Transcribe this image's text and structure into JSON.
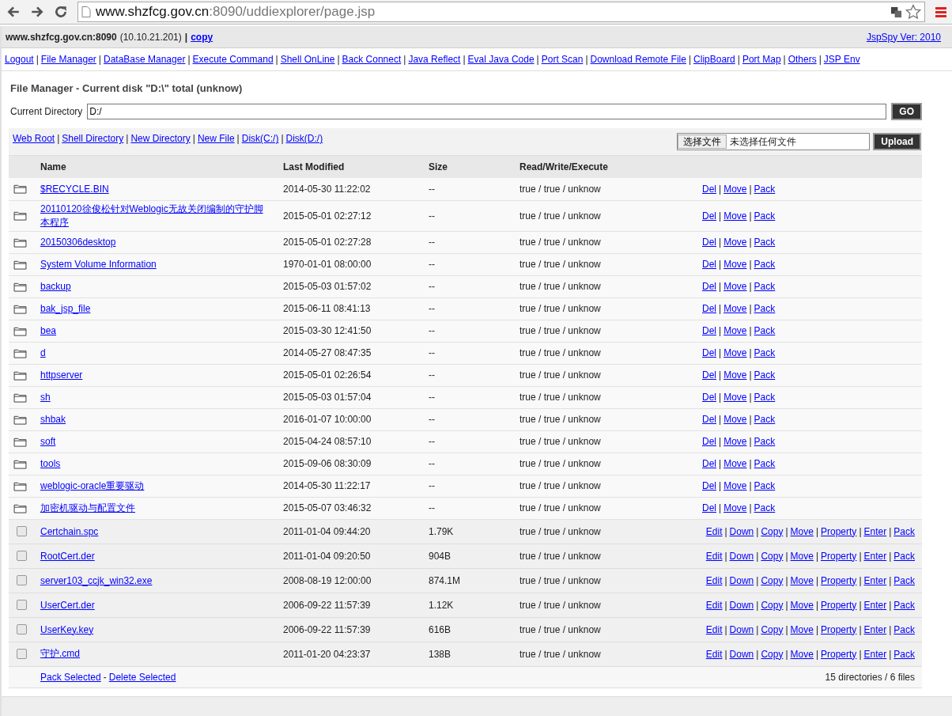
{
  "browser": {
    "url_host": "www.shzfcg.gov.cn",
    "url_rest": ":8090/uddiexplorer/page.jsp"
  },
  "info_bar": {
    "host": "www.shzfcg.gov.cn:8090",
    "ip": "(10.10.21.201)",
    "separator": "|",
    "copy_link": "copy",
    "version_link": "JspSpy Ver: 2010"
  },
  "nav_separator": "|",
  "nav_links": [
    "Logout",
    "File Manager",
    "DataBase Manager",
    "Execute Command",
    "Shell OnLine",
    "Back Connect",
    "Java Reflect",
    "Eval Java Code",
    "Port Scan",
    "Download Remote File",
    "ClipBoard",
    "Port Map",
    "Others",
    "JSP Env"
  ],
  "page_title": "File Manager - Current disk \"D:\\\" total (unknow)",
  "current_directory": {
    "label": "Current Directory",
    "value": "D:/",
    "button": "GO"
  },
  "quick_links_separator": "|",
  "quick_links": [
    "Web Root",
    "Shell Directory",
    "New Directory",
    "New File",
    "Disk(C:/)",
    "Disk(D:/)"
  ],
  "upload": {
    "choose_button": "选择文件",
    "file_status": "未选择任何文件",
    "button": "Upload"
  },
  "table": {
    "action_separator": "|",
    "columns": [
      "Name",
      "Last Modified",
      "Size",
      "Read/Write/Execute"
    ],
    "rows": [
      {
        "kind": "directory",
        "name": "$RECYCLE.BIN",
        "modified": "2014-05-30 11:22:02",
        "size": "--",
        "permissions": "true / true / unknow",
        "actions": [
          "Del",
          "Move",
          "Pack"
        ]
      },
      {
        "kind": "directory",
        "name": "20110120徐俊松针对Weblogic无故关闭编制的守护脚本程序",
        "modified": "2015-05-01 02:27:12",
        "size": "--",
        "permissions": "true / true / unknow",
        "actions": [
          "Del",
          "Move",
          "Pack"
        ]
      },
      {
        "kind": "directory",
        "name": "20150306desktop",
        "modified": "2015-05-01 02:27:28",
        "size": "--",
        "permissions": "true / true / unknow",
        "actions": [
          "Del",
          "Move",
          "Pack"
        ]
      },
      {
        "kind": "directory",
        "name": "System Volume Information",
        "modified": "1970-01-01 08:00:00",
        "size": "--",
        "permissions": "true / true / unknow",
        "actions": [
          "Del",
          "Move",
          "Pack"
        ]
      },
      {
        "kind": "directory",
        "name": "backup",
        "modified": "2015-05-03 01:57:02",
        "size": "--",
        "permissions": "true / true / unknow",
        "actions": [
          "Del",
          "Move",
          "Pack"
        ]
      },
      {
        "kind": "directory",
        "name": "bak_jsp_file",
        "modified": "2015-06-11 08:41:13",
        "size": "--",
        "permissions": "true / true / unknow",
        "actions": [
          "Del",
          "Move",
          "Pack"
        ]
      },
      {
        "kind": "directory",
        "name": "bea",
        "modified": "2015-03-30 12:41:50",
        "size": "--",
        "permissions": "true / true / unknow",
        "actions": [
          "Del",
          "Move",
          "Pack"
        ]
      },
      {
        "kind": "directory",
        "name": "d",
        "modified": "2014-05-27 08:47:35",
        "size": "--",
        "permissions": "true / true / unknow",
        "actions": [
          "Del",
          "Move",
          "Pack"
        ]
      },
      {
        "kind": "directory",
        "name": "httpserver",
        "modified": "2015-05-01 02:26:54",
        "size": "--",
        "permissions": "true / true / unknow",
        "actions": [
          "Del",
          "Move",
          "Pack"
        ]
      },
      {
        "kind": "directory",
        "name": "sh",
        "modified": "2015-05-03 01:57:04",
        "size": "--",
        "permissions": "true / true / unknow",
        "actions": [
          "Del",
          "Move",
          "Pack"
        ]
      },
      {
        "kind": "directory",
        "name": "shbak",
        "modified": "2016-01-07 10:00:00",
        "size": "--",
        "permissions": "true / true / unknow",
        "actions": [
          "Del",
          "Move",
          "Pack"
        ]
      },
      {
        "kind": "directory",
        "name": "soft",
        "modified": "2015-04-24 08:57:10",
        "size": "--",
        "permissions": "true / true / unknow",
        "actions": [
          "Del",
          "Move",
          "Pack"
        ]
      },
      {
        "kind": "directory",
        "name": "tools",
        "modified": "2015-09-06 08:30:09",
        "size": "--",
        "permissions": "true / true / unknow",
        "actions": [
          "Del",
          "Move",
          "Pack"
        ]
      },
      {
        "kind": "directory",
        "name": "weblogic-oracle重要驱动",
        "modified": "2014-05-30 11:22:17",
        "size": "--",
        "permissions": "true / true / unknow",
        "actions": [
          "Del",
          "Move",
          "Pack"
        ]
      },
      {
        "kind": "directory",
        "name": "加密机驱动与配置文件",
        "modified": "2015-05-07 03:46:32",
        "size": "--",
        "permissions": "true / true / unknow",
        "actions": [
          "Del",
          "Move",
          "Pack"
        ]
      },
      {
        "kind": "file",
        "checked": false,
        "name": "Certchain.spc",
        "modified": "2011-01-04 09:44:20",
        "size": "1.79K",
        "permissions": "true / true / unknow",
        "actions": [
          "Edit",
          "Down",
          "Copy",
          "Move",
          "Property",
          "Enter",
          "Pack"
        ]
      },
      {
        "kind": "file",
        "checked": false,
        "name": "RootCert.der",
        "modified": "2011-01-04 09:20:50",
        "size": "904B",
        "permissions": "true / true / unknow",
        "actions": [
          "Edit",
          "Down",
          "Copy",
          "Move",
          "Property",
          "Enter",
          "Pack"
        ]
      },
      {
        "kind": "file",
        "checked": false,
        "name": "server103_ccjk_win32.exe",
        "modified": "2008-08-19 12:00:00",
        "size": "874.1M",
        "permissions": "true / true / unknow",
        "actions": [
          "Edit",
          "Down",
          "Copy",
          "Move",
          "Property",
          "Enter",
          "Pack"
        ]
      },
      {
        "kind": "file",
        "checked": false,
        "name": "UserCert.der",
        "modified": "2006-09-22 11:57:39",
        "size": "1.12K",
        "permissions": "true / true / unknow",
        "actions": [
          "Edit",
          "Down",
          "Copy",
          "Move",
          "Property",
          "Enter",
          "Pack"
        ]
      },
      {
        "kind": "file",
        "checked": false,
        "name": "UserKey.key",
        "modified": "2006-09-22 11:57:39",
        "size": "616B",
        "permissions": "true / true / unknow",
        "actions": [
          "Edit",
          "Down",
          "Copy",
          "Move",
          "Property",
          "Enter",
          "Pack"
        ]
      },
      {
        "kind": "file",
        "checked": false,
        "name": "守护.cmd",
        "modified": "2011-01-20 04:23:37",
        "size": "138B",
        "permissions": "true / true / unknow",
        "actions": [
          "Edit",
          "Down",
          "Copy",
          "Move",
          "Property",
          "Enter",
          "Pack"
        ]
      }
    ]
  },
  "footer_separator": "-",
  "footer_links": [
    "Pack Selected",
    "Delete Selected"
  ],
  "summary": "15 directories / 6 files"
}
